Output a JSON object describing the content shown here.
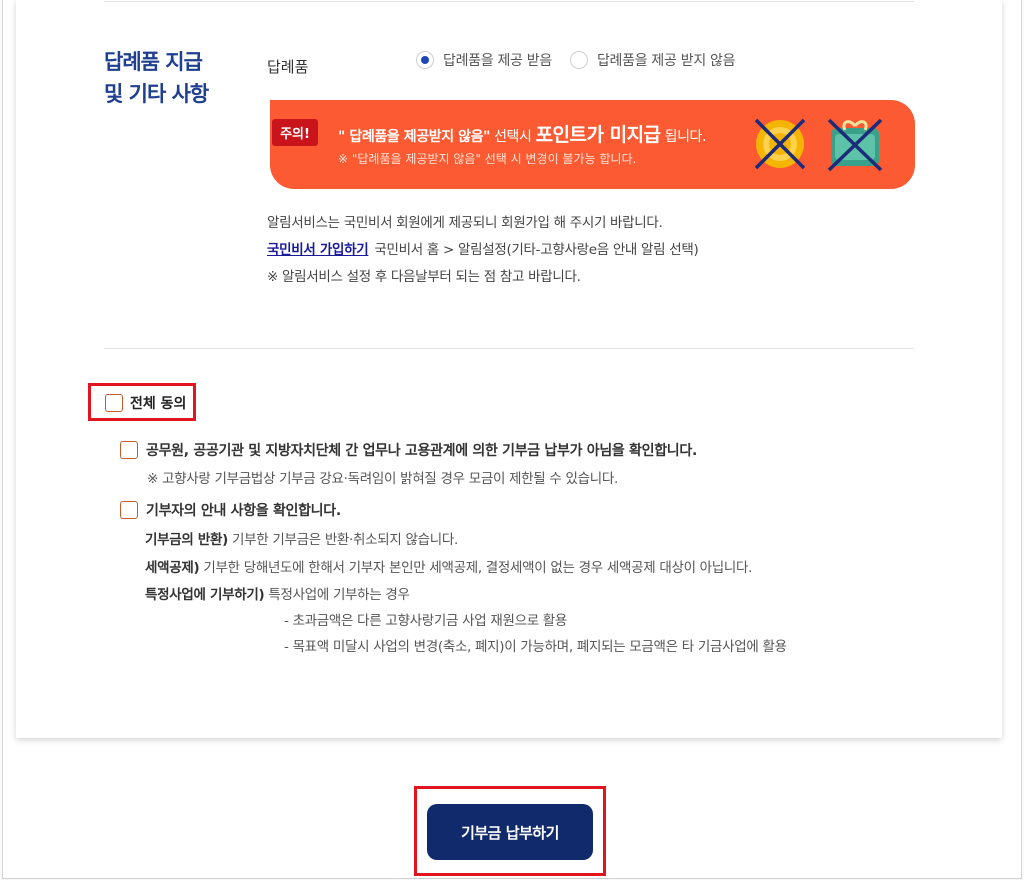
{
  "section": {
    "title_line1": "답례품 지급",
    "title_line2": "및 기타 사항"
  },
  "gift": {
    "label": "답례품",
    "options": [
      {
        "label": "답례품을 제공 받음",
        "selected": true
      },
      {
        "label": "답례품을 제공 받지 않음",
        "selected": false
      }
    ]
  },
  "notice": {
    "badge": "주의!",
    "line1_pre": "\" 답례품을 제공받지 않음\"",
    "line1_mid": " 선택시 ",
    "line1_emph": "포인트가 미지급",
    "line1_post": " 됩니다.",
    "line2": "※ \"답례품을 제공받지 않음\" 선택 시 변경이 불가능 합니다.",
    "coin_color": "#f4b400",
    "gift_color": "#3aa08a",
    "cross_color": "#1c2a7a",
    "bg_color": "#fb5a32"
  },
  "info": {
    "line1": "알림서비스는 국민비서 회원에게 제공되니 회원가입 해 주시기 바랍니다.",
    "link": "국민비서 가입하기",
    "line2_rest": "국민비서 홈 > 알림설정(기타-고향사랑e음 안내 알림 선택)",
    "line3": "※ 알림서비스 설정 후 다음날부터 되는 점 참고 바랍니다."
  },
  "agree": {
    "all_label": "전체 동의",
    "item1_label": "공무원, 공공기관 및 지방자치단체 간 업무나 고용관계에 의한 기부금 납부가 아님을 확인합니다.",
    "item1_sub": "※ 고향사랑 기부금법상 기부금 강요·독려임이 밝혀질 경우 모금이 제한될 수 있습니다.",
    "item2_label": "기부자의 안내 사항을 확인합니다.",
    "d1_key": "기부금의 반환)",
    "d1_val": " 기부한 기부금은 반환·취소되지 않습니다.",
    "d2_key": "세액공제)",
    "d2_val": " 기부한 당해년도에 한해서 기부자 본인만 세액공제, 결정세액이 없는 경우 세액공제 대상이 아닙니다.",
    "d3_key": "특정사업에 기부하기)",
    "d3_val": " 특정사업에 기부하는 경우",
    "d4": "- 초과금액은 다른 고향사랑기금 사업 재원으로 활용",
    "d5": "- 목표액 미달시 사업의 변경(축소, 폐지)이 가능하며, 폐지되는 모금액은 타 기금사업에 활용"
  },
  "submit": {
    "label": "기부금 납부하기",
    "color": "#112a6b"
  },
  "highlight_color": "#e1141f"
}
